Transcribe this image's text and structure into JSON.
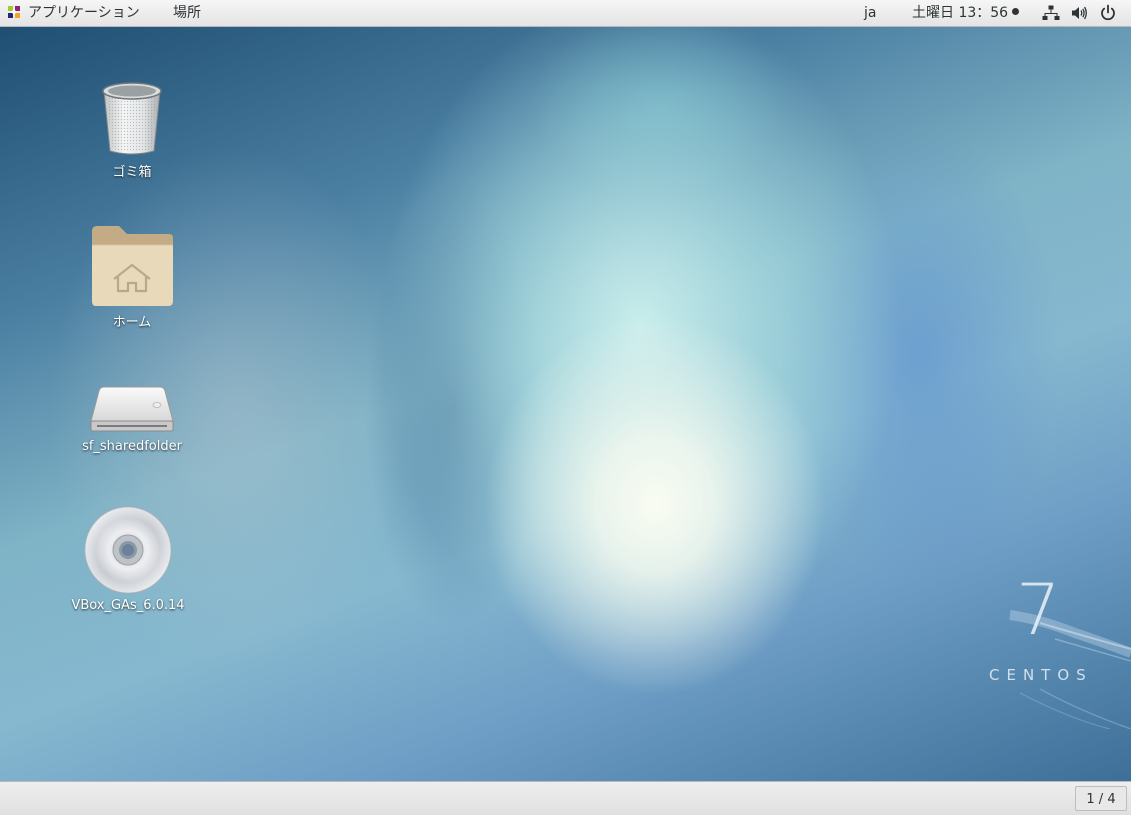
{
  "top_panel": {
    "applications_label": "アプリケーション",
    "places_label": "場所",
    "input_method": "ja",
    "clock": "土曜日 13：56",
    "tray_icons": [
      "network-icon",
      "volume-icon",
      "power-icon"
    ]
  },
  "desktop": {
    "icons": [
      {
        "label": "ゴミ箱",
        "icon": "trash-icon"
      },
      {
        "label": "ホーム",
        "icon": "home-folder-icon"
      },
      {
        "label": "sf_sharedfolder",
        "icon": "drive-icon"
      },
      {
        "label": "VBox_GAs_6.0.14",
        "icon": "optical-disc-icon"
      }
    ],
    "branding": {
      "number": "7",
      "text": "CENTOS"
    }
  },
  "bottom_panel": {
    "workspace": "1 / 4"
  },
  "colors": {
    "panel_bg": "#e8e8e8",
    "panel_text": "#2e3436",
    "desktop_dark": "#2f5f86",
    "desktop_light": "#f5f9ef"
  }
}
